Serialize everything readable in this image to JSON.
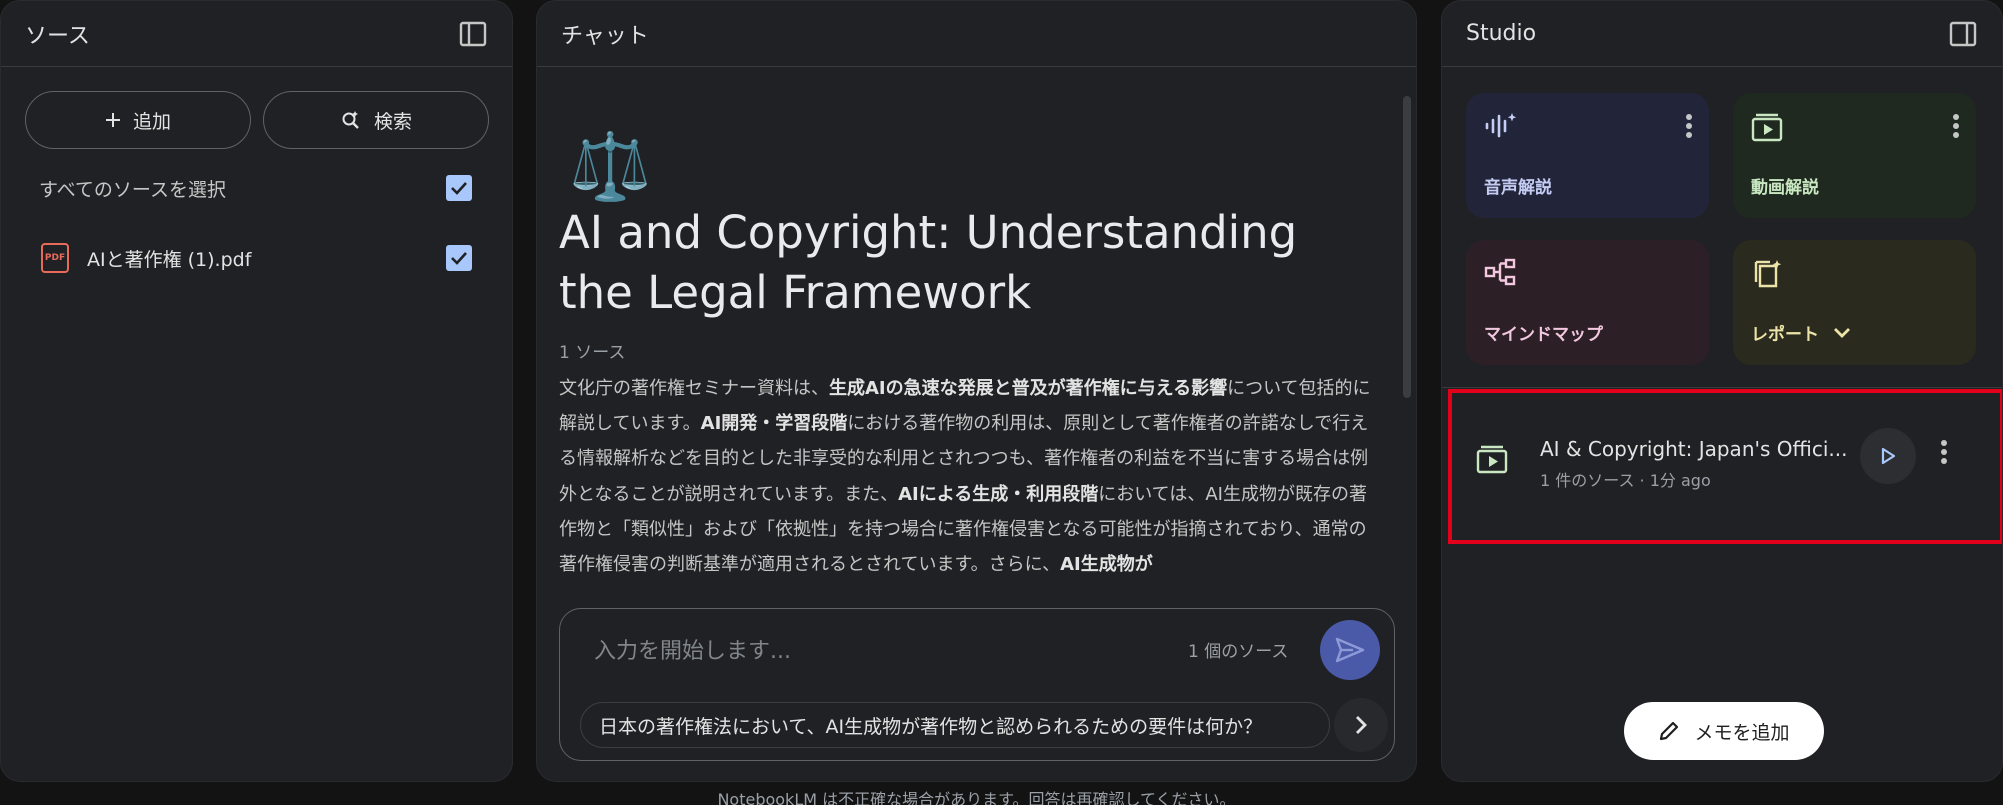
{
  "sources": {
    "title": "ソース",
    "add_label": "追加",
    "search_label": "検索",
    "select_all_label": "すべてのソースを選択",
    "select_all_checked": true,
    "items": [
      {
        "name": "AIと著作権 (1).pdf",
        "type": "PDF",
        "checked": true
      }
    ]
  },
  "chat": {
    "title": "チャット",
    "emoji": "⚖️",
    "doc_title": "AI and Copyright: Understanding the Legal Framework",
    "source_count": "1 ソース",
    "summary": [
      {
        "t": "文化庁の著作権セミナー資料は、",
        "b": false
      },
      {
        "t": "生成AIの急速な発展と普及が著作権に与える影響",
        "b": true
      },
      {
        "t": "について包括的に解説しています。",
        "b": false
      },
      {
        "t": "AI開発・学習段階",
        "b": true
      },
      {
        "t": "における著作物の利用は、原則として著作権者の許諾なしで行える情報解析などを目的とした非享受的な利用とされつつも、著作権者の利益を不当に害する場合は例外となることが説明されています。また、",
        "b": false
      },
      {
        "t": "AIによる生成・利用段階",
        "b": true
      },
      {
        "t": "においては、AI生成物が既存の著作物と「類似性」および「依拠性」を持つ場合に著作権侵害となる可能性が指摘されており、通常の著作権侵害の判断基準が適用されるとされています。さらに、",
        "b": false
      },
      {
        "t": "AI生成物が",
        "b": true
      }
    ],
    "input_placeholder": "入力を開始します...",
    "input_source_count": "1 個のソース",
    "suggestion": "日本の著作権法において、AI生成物が著作物と認められるための要件は何か？",
    "disclaimer": "NotebookLM は不正確な場合があります。回答は再確認してください。"
  },
  "studio": {
    "title": "Studio",
    "tiles": [
      {
        "label": "音声解説",
        "icon": "audio-waveform-icon",
        "color": "#c5cdf4"
      },
      {
        "label": "動画解説",
        "icon": "video-overview-icon",
        "color": "#c9e8c2"
      },
      {
        "label": "マインドマップ",
        "icon": "mind-map-icon",
        "color": "#f2c7df"
      },
      {
        "label": "レポート",
        "icon": "report-icon",
        "color": "#ece3a8"
      }
    ],
    "artifact": {
      "title": "AI & Copyright: Japan's Offici...",
      "meta": "1 件のソース · 1分 ago"
    },
    "add_note_label": "メモを追加"
  }
}
